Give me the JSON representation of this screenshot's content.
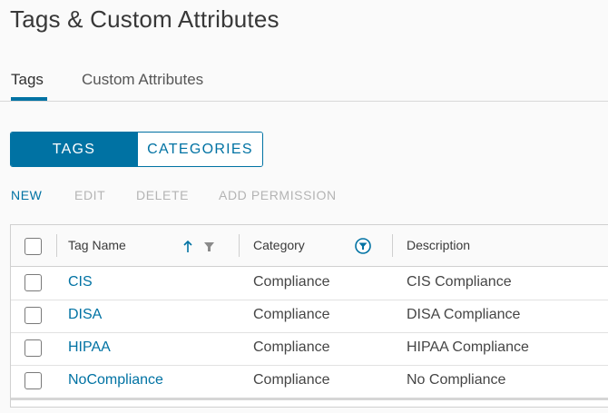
{
  "page": {
    "title": "Tags & Custom Attributes"
  },
  "tabs": [
    {
      "label": "Tags",
      "active": true
    },
    {
      "label": "Custom Attributes",
      "active": false
    }
  ],
  "toggle": {
    "tags": "TAGS",
    "categories": "CATEGORIES",
    "selected": "TAGS"
  },
  "actions": {
    "new": "NEW",
    "edit": "EDIT",
    "delete": "DELETE",
    "add_permission": "ADD PERMISSION"
  },
  "grid": {
    "columns": {
      "tag_name": "Tag Name",
      "category": "Category",
      "description": "Description"
    },
    "sort": {
      "column": "Tag Name",
      "direction": "ascending"
    },
    "rows": [
      {
        "tag_name": "CIS",
        "category": "Compliance",
        "description": "CIS Compliance"
      },
      {
        "tag_name": "DISA",
        "category": "Compliance",
        "description": "DISA Compliance"
      },
      {
        "tag_name": "HIPAA",
        "category": "Compliance",
        "description": "HIPAA Compliance"
      },
      {
        "tag_name": "NoCompliance",
        "category": "Compliance",
        "description": "No Compliance"
      }
    ]
  },
  "colors": {
    "accent": "#0072a3",
    "disabled": "#b4b4b4"
  }
}
